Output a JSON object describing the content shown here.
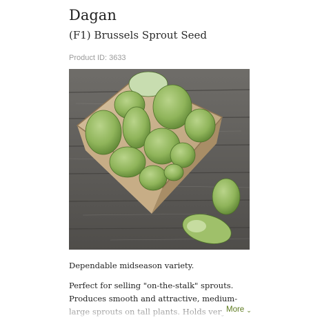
{
  "product": {
    "title": "Dagan",
    "subtitle": "(F1) Brussels Sprout Seed",
    "product_id": "Product ID: 3633"
  },
  "image": {
    "icon": "brussels-sprouts-photo"
  },
  "description": {
    "line1": "Dependable midseason variety.",
    "paragraph": "Perfect for selling \"on-the-stalk\" sprouts. Produces smooth and attractive, medium-large sprouts on tall plants. Holds very well in th",
    "more_label": "More",
    "more_icon": "chevron-down-icon"
  },
  "colors": {
    "accent": "#5d7a1e",
    "muted": "#9a9a9a"
  }
}
